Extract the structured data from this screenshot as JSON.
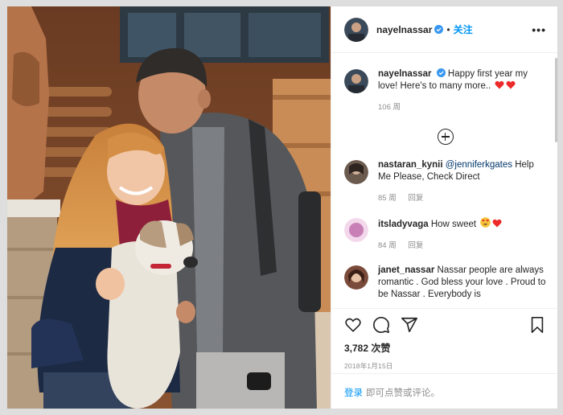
{
  "post": {
    "username": "nayelnassar",
    "follow_label": "关注",
    "separator": "•",
    "more_label": "•••",
    "caption": {
      "username": "nayelnassar",
      "text": "Happy first year my love! Here's to many more..",
      "emoji": [
        "heart",
        "heart"
      ],
      "time": "106 周"
    },
    "comments": [
      {
        "username": "nastaran_kynii",
        "mention": "@jenniferkgates",
        "text": " Help Me Please, Check Direct",
        "time": "85 周",
        "reply_label": "回复",
        "avatar_color": "#6b5a4e"
      },
      {
        "username": "itsladyvaga",
        "text": "How sweet",
        "emoji": [
          "heart-eyes-face",
          "heart"
        ],
        "time": "84 周",
        "reply_label": "回复",
        "avatar_color": "#c77fb5"
      },
      {
        "username": "janet_nassar",
        "text": "Nassar people are always romantic . God bless your love . Proud to be Nassar . Everybody is",
        "avatar_color": "#7a4a3a"
      }
    ],
    "likes": "3,782 次赞",
    "date": "2018年1月15日",
    "login_link": "登录",
    "login_text": "即可点赞或评论。",
    "colors": {
      "link": "#0095f6",
      "mention": "#00376b",
      "heart": "#ed2a2a",
      "muted": "#8e8e8e"
    }
  }
}
